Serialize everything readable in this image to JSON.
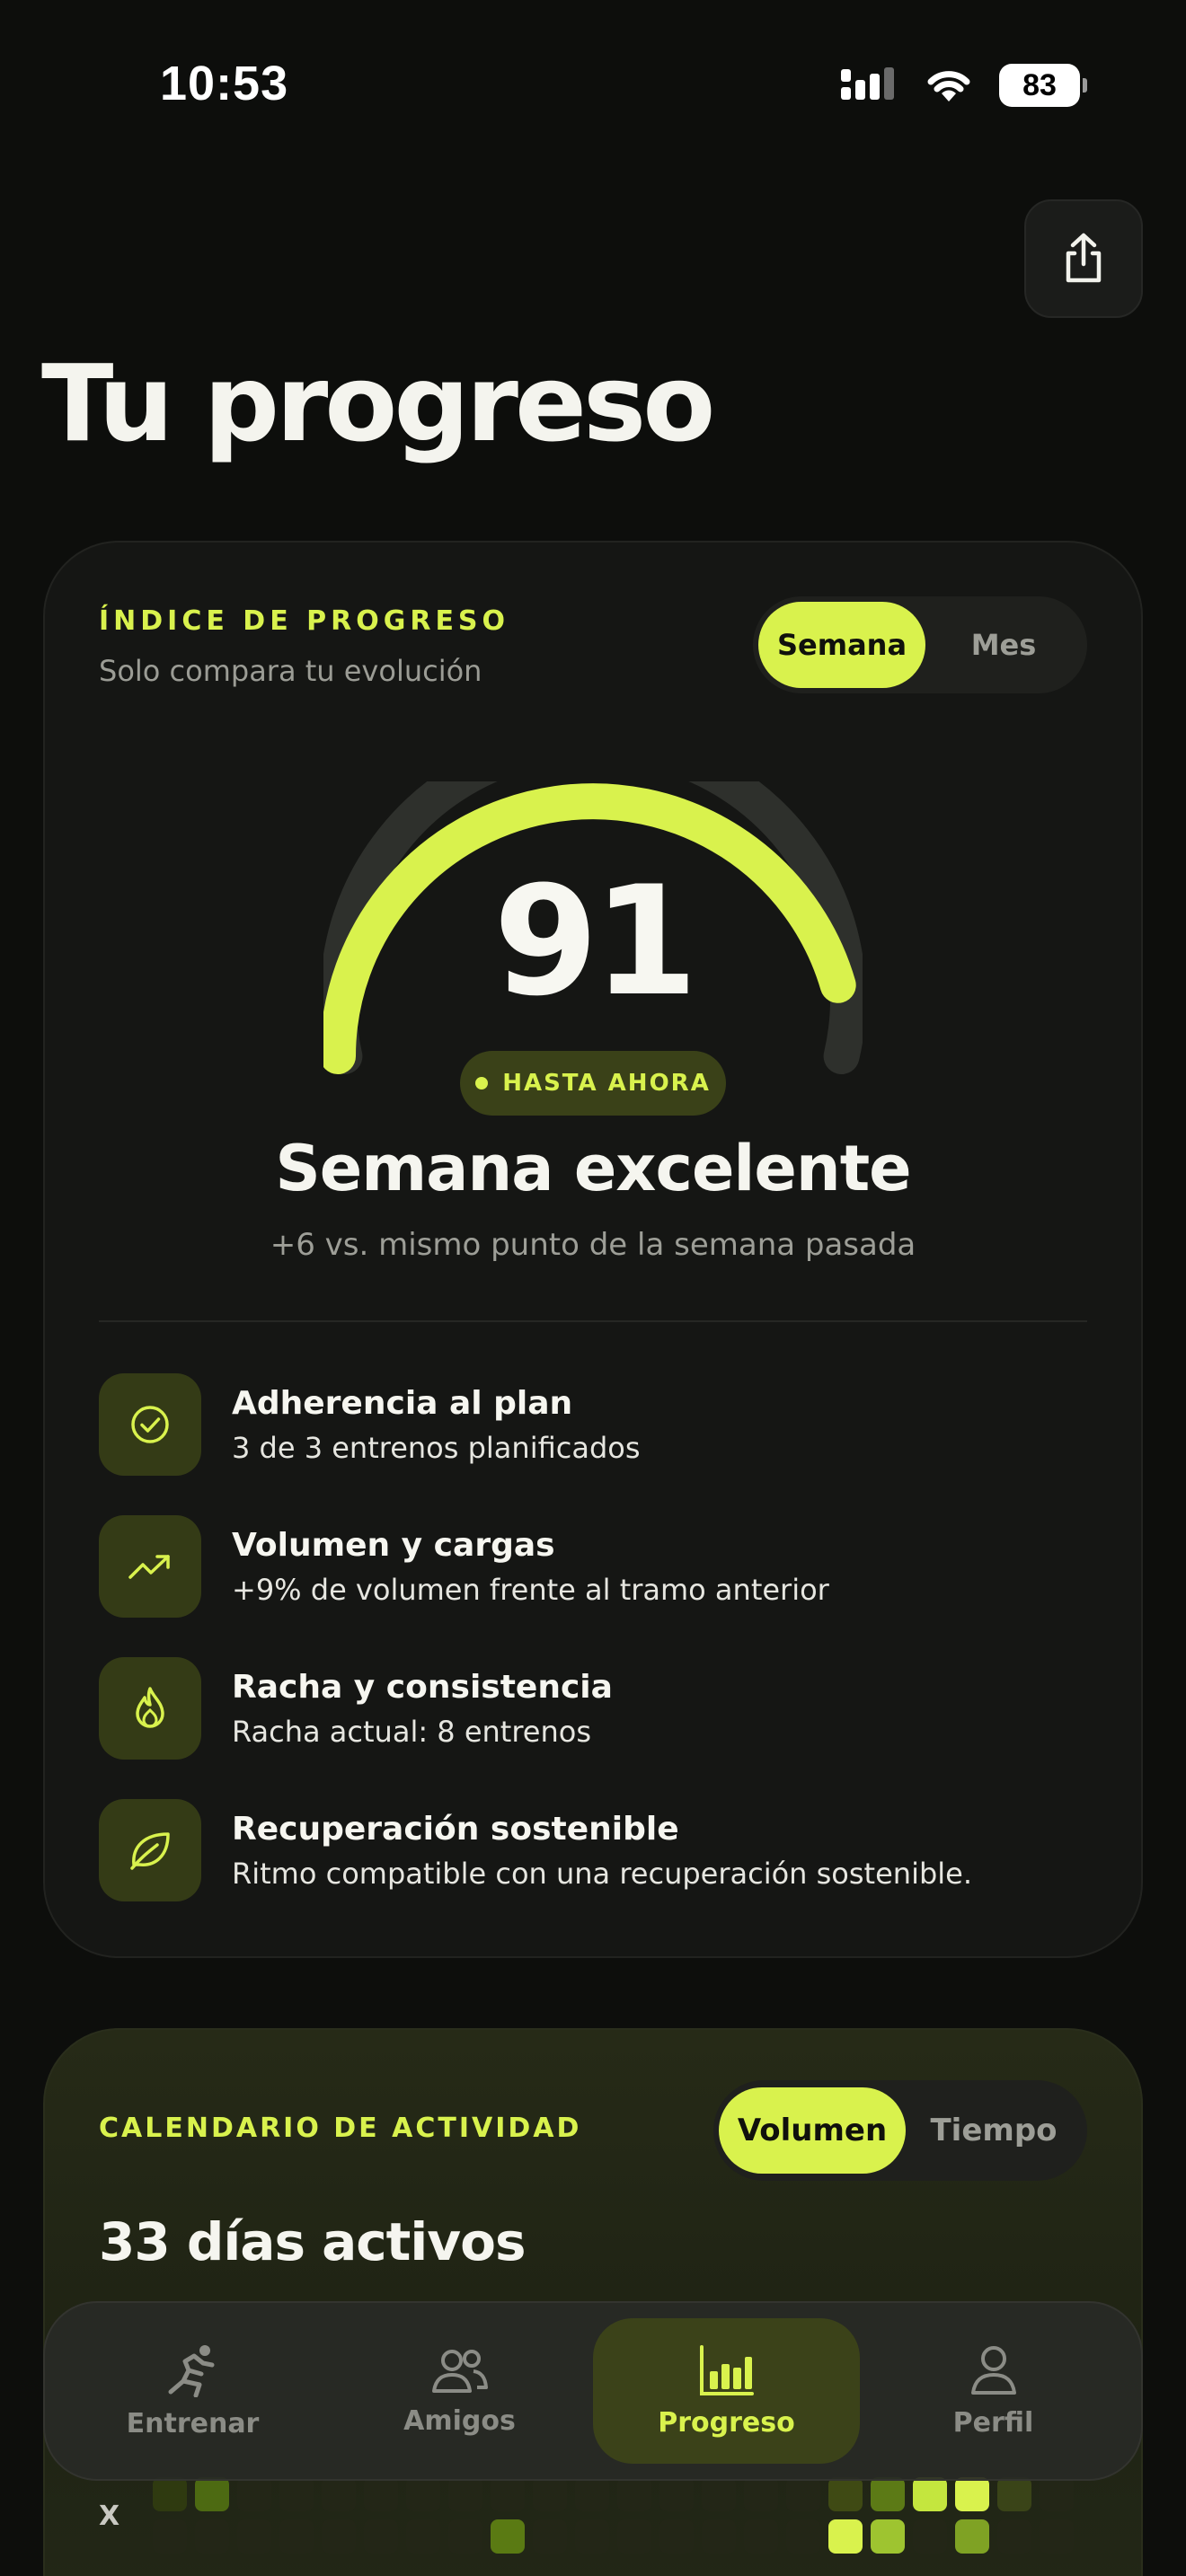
{
  "status_bar": {
    "time": "10:53",
    "battery": "83"
  },
  "header": {
    "title": "Tu progreso"
  },
  "progress_card": {
    "eyebrow": "ÍNDICE DE PROGRESO",
    "subtitle": "Solo compara tu evolución",
    "tabs": [
      {
        "label": "Semana",
        "active": true
      },
      {
        "label": "Mes",
        "active": false
      }
    ],
    "score": "91",
    "gauge_fraction": 0.91,
    "chip": "HASTA AHORA",
    "verdict": "Semana excelente",
    "delta": "+6 vs. mismo punto de la semana pasada",
    "metrics": [
      {
        "icon": "check-circle-icon",
        "title": "Adherencia al plan",
        "desc": "3 de 3 entrenos planificados"
      },
      {
        "icon": "trend-up-icon",
        "title": "Volumen y cargas",
        "desc": "+9% de volumen frente al tramo anterior"
      },
      {
        "icon": "flame-icon",
        "title": "Racha y consistencia",
        "desc": "Racha actual: 8 entrenos"
      },
      {
        "icon": "leaf-icon",
        "title": "Recuperación sostenible",
        "desc": "Ritmo compatible con una recuperación sostenible."
      }
    ]
  },
  "activity_card": {
    "eyebrow": "CALENDARIO DE ACTIVIDAD",
    "tabs": [
      {
        "label": "Volumen",
        "active": true
      },
      {
        "label": "Tiempo",
        "active": false
      }
    ],
    "days": "33 días activos",
    "row_label": "X"
  },
  "bottom_nav": {
    "items": [
      {
        "icon": "runner-icon",
        "label": "Entrenar",
        "active": false
      },
      {
        "icon": "friends-icon",
        "label": "Amigos",
        "active": false
      },
      {
        "icon": "bar-chart-icon",
        "label": "Progreso",
        "active": true
      },
      {
        "icon": "person-icon",
        "label": "Perfil",
        "active": false
      }
    ]
  },
  "colors": {
    "accent": "#d9f24d",
    "background": "#0d0e0c",
    "card": "#151614"
  }
}
